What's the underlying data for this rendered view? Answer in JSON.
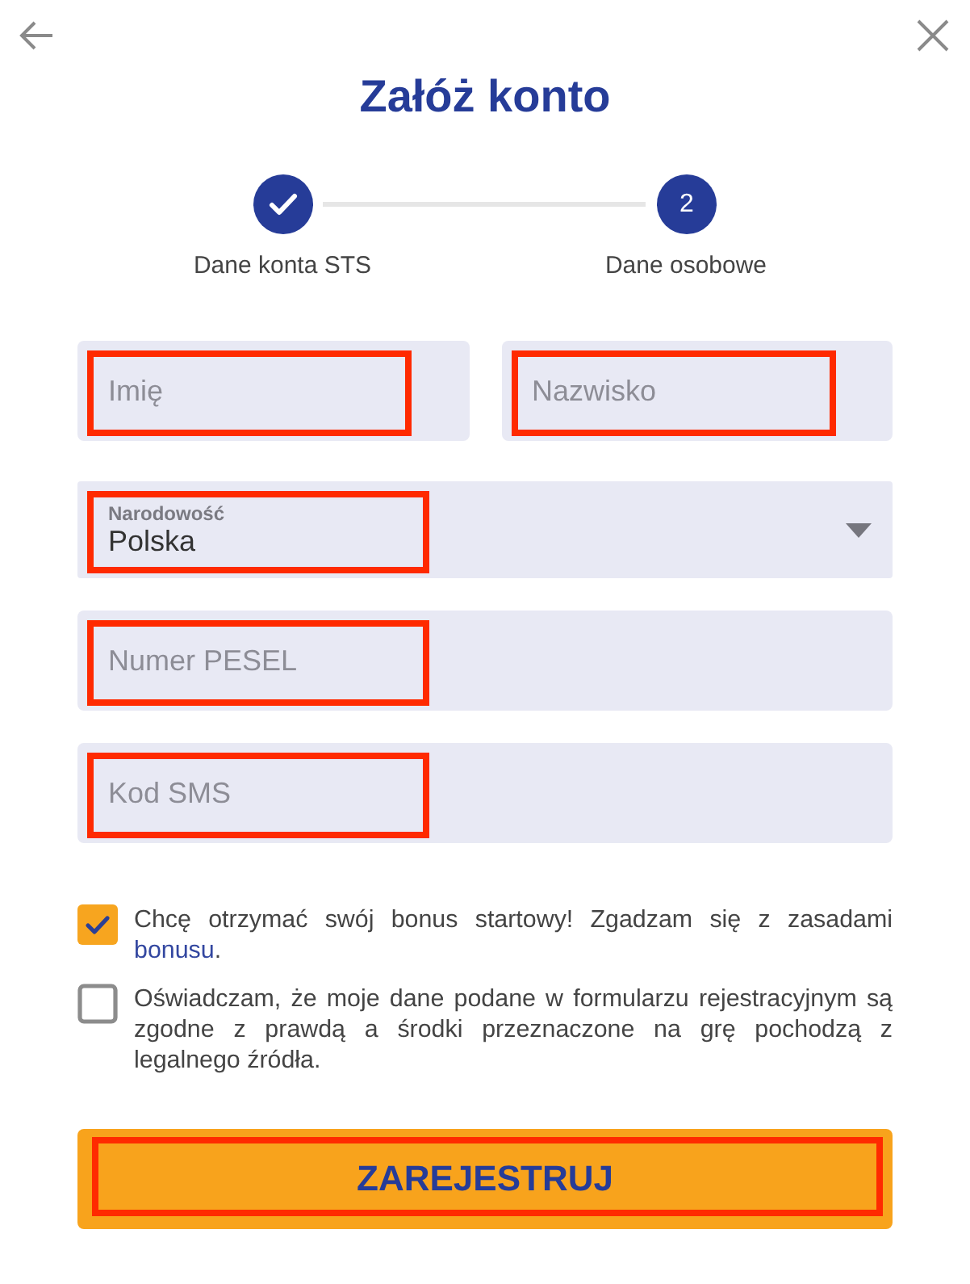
{
  "header": {
    "title": "Załóż konto"
  },
  "stepper": {
    "steps": [
      {
        "label": "Dane konta STS",
        "completed": true
      },
      {
        "label": "Dane osobowe",
        "number": "2",
        "completed": false
      }
    ]
  },
  "form": {
    "rows": [
      {
        "fields": [
          {
            "kind": "text",
            "placeholder": "Imię",
            "highlighted": true
          },
          {
            "kind": "text",
            "placeholder": "Nazwisko",
            "highlighted": true
          }
        ]
      },
      {
        "fields": [
          {
            "kind": "select",
            "label": "Narodowość",
            "value": "Polska",
            "highlighted": true
          }
        ]
      },
      {
        "fields": [
          {
            "kind": "text",
            "placeholder": "Numer PESEL",
            "highlighted": true
          }
        ]
      },
      {
        "fields": [
          {
            "kind": "text",
            "placeholder": "Kod SMS",
            "highlighted": true
          }
        ]
      }
    ]
  },
  "consents": [
    {
      "checked": true,
      "text": "Chcę otrzymać swój bonus startowy! Zgadzam się z zasadami ",
      "link": "bonusu",
      "text_after": "."
    },
    {
      "checked": false,
      "text": "Oświadczam, że moje dane podane w formularzu rejestracyjnym są zgodne z prawdą a środki przeznaczone na grę pochodzą z legalnego źródła."
    }
  ],
  "submit": {
    "label": "ZAREJESTRUJ",
    "highlighted": true
  }
}
